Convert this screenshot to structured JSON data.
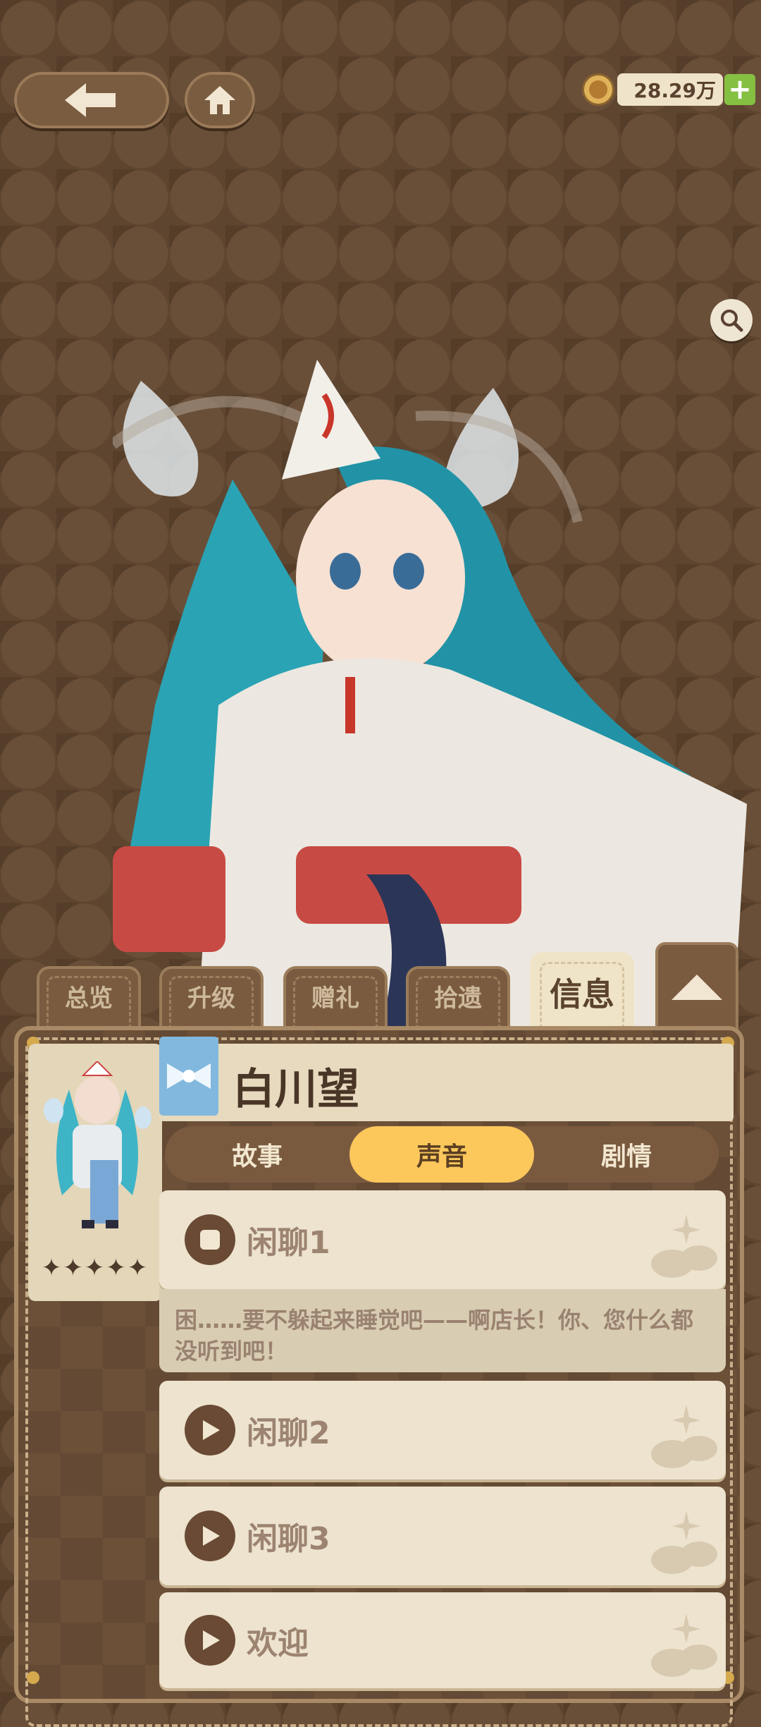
{
  "currency": {
    "amount": "28.29万",
    "plus": "+"
  },
  "tabs": [
    {
      "label": "总览"
    },
    {
      "label": "升级"
    },
    {
      "label": "赠礼"
    },
    {
      "label": "拾遗"
    },
    {
      "label": "信息",
      "active": true
    }
  ],
  "character": {
    "name": "白川望",
    "rarity": "✦✦✦✦✦",
    "stars": 5
  },
  "subtabs": [
    {
      "label": "故事"
    },
    {
      "label": "声音",
      "active": true
    },
    {
      "label": "剧情"
    }
  ],
  "voices": [
    {
      "label": "闲聊1",
      "playing": true,
      "line": "困……要不躲起来睡觉吧——啊店长！你、您什么都没听到吧！"
    },
    {
      "label": "闲聊2"
    },
    {
      "label": "闲聊3"
    },
    {
      "label": "欢迎"
    }
  ],
  "colors": {
    "accent": "#fcc85c",
    "panel": "#6c5038",
    "card": "#ede3cf",
    "plus": "#86c043"
  }
}
